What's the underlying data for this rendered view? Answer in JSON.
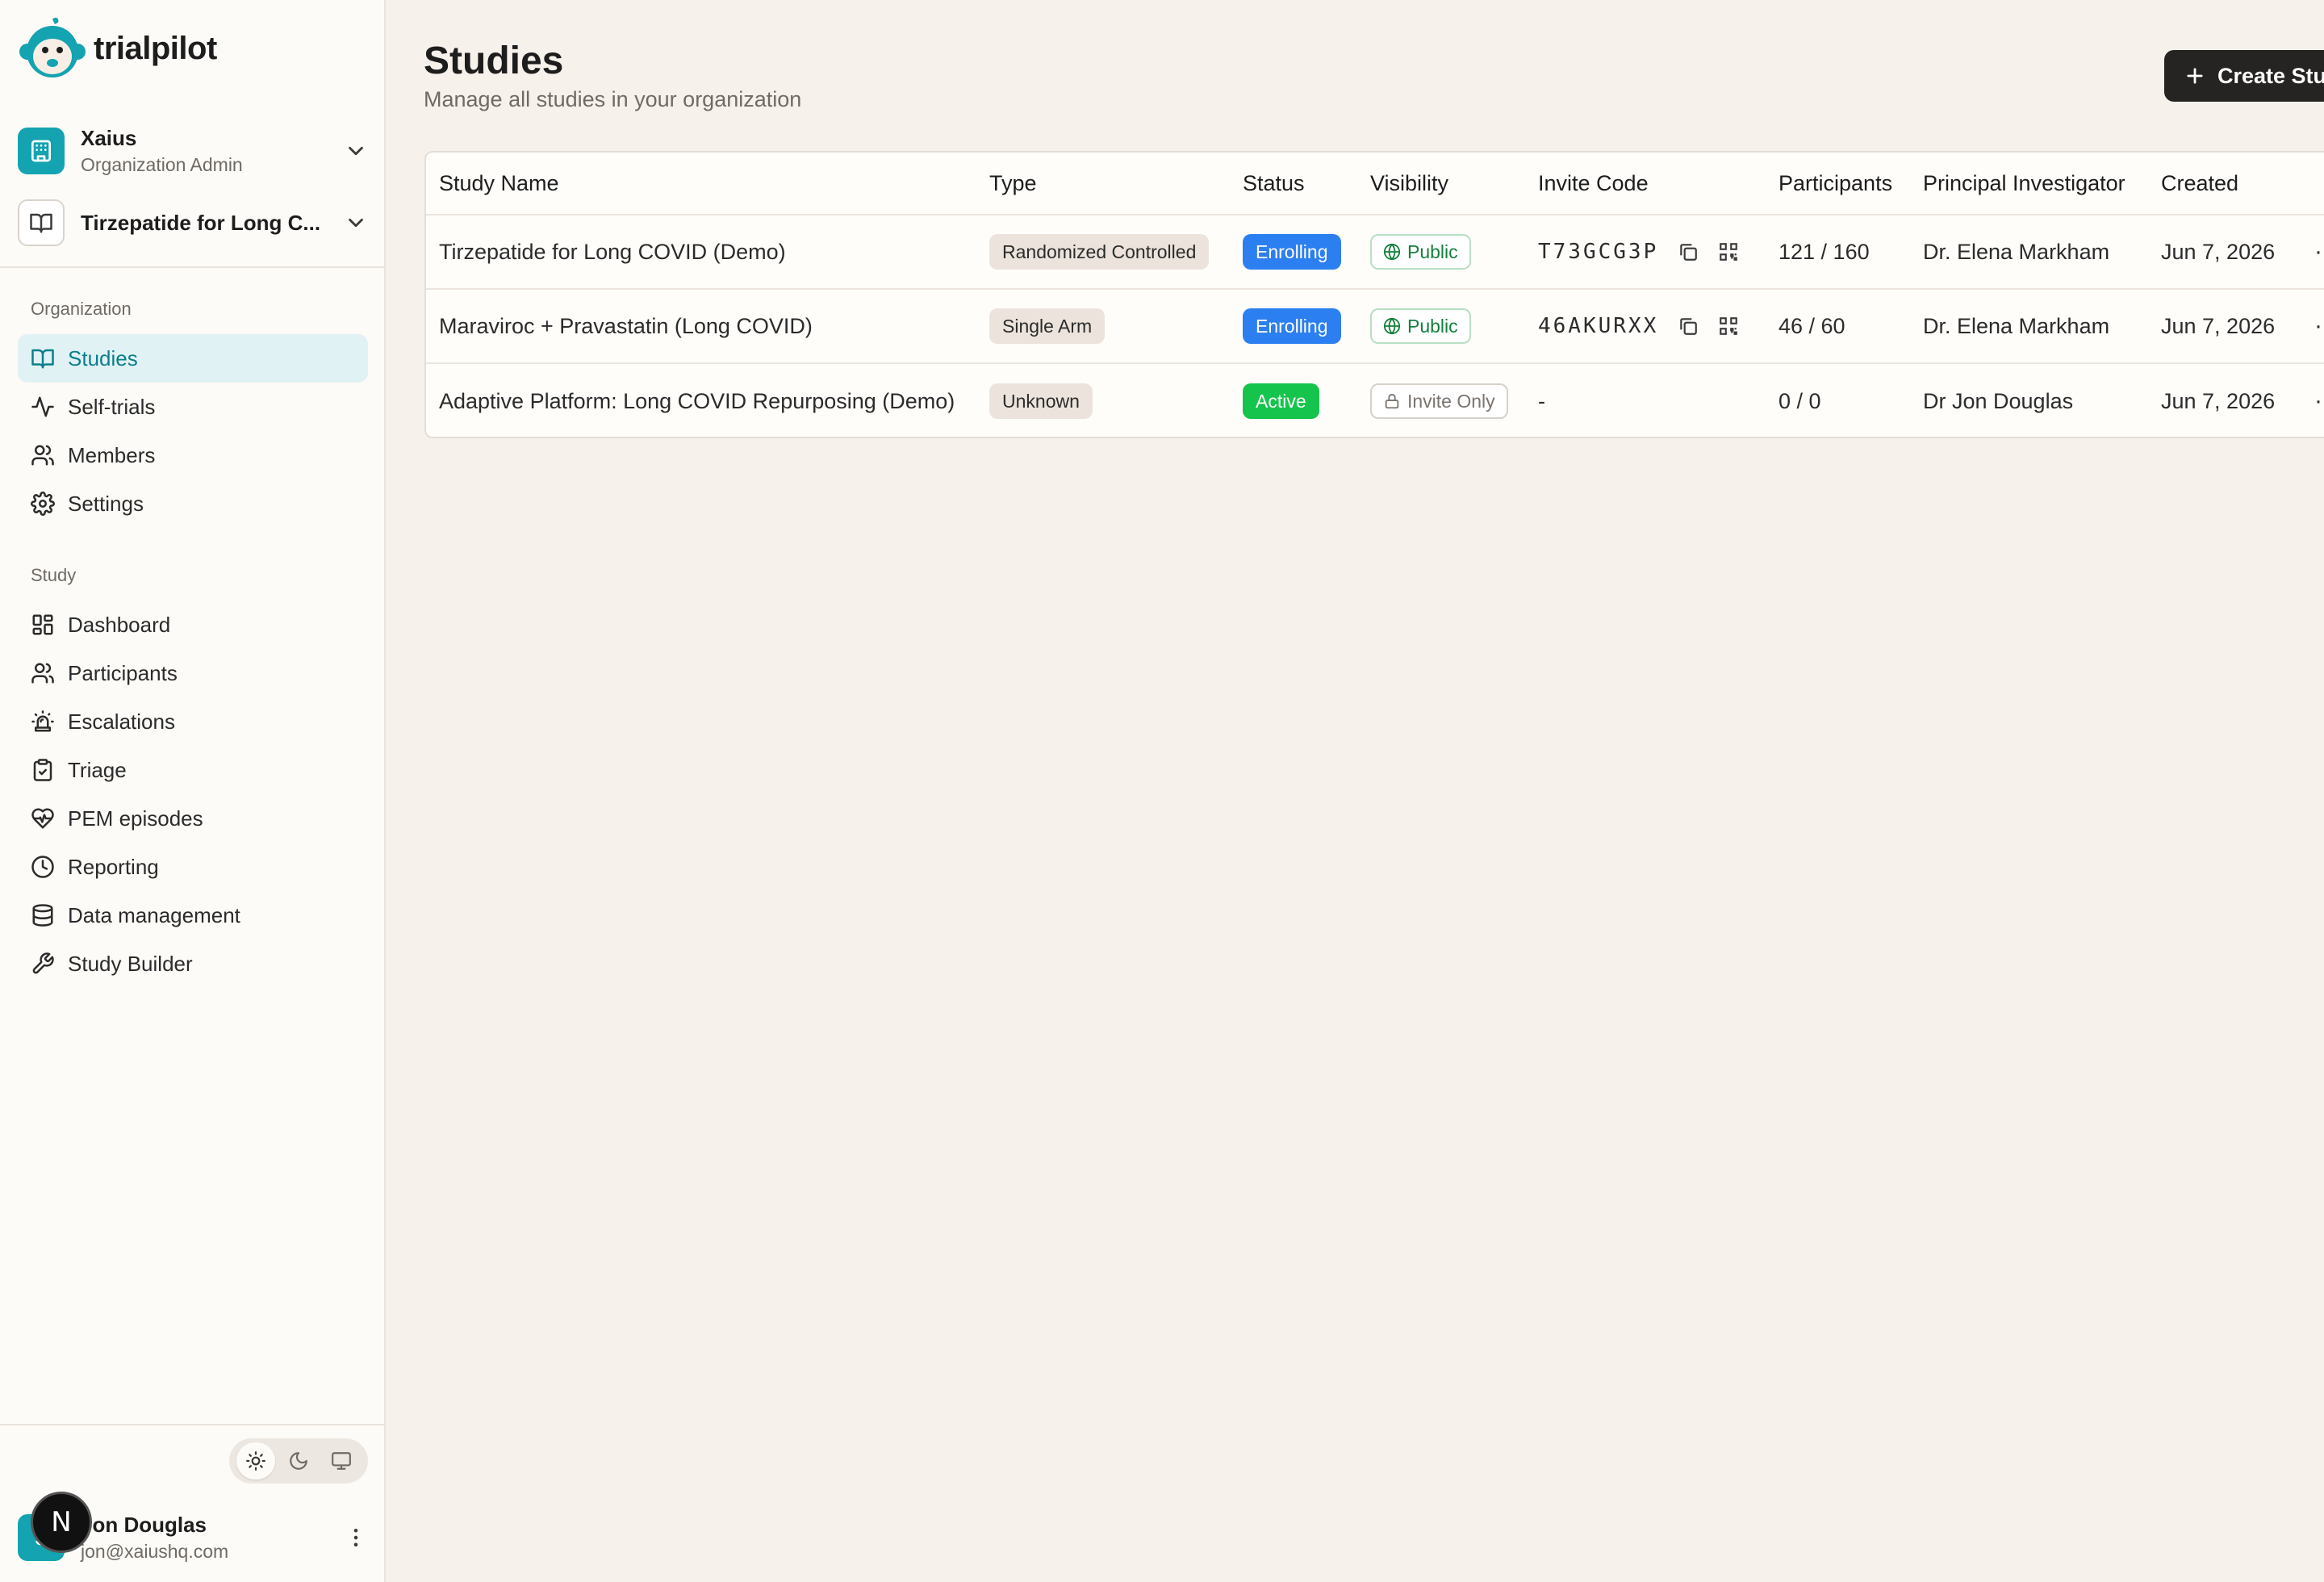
{
  "app": {
    "name": "trialpilot"
  },
  "org_switcher": {
    "name": "Xaius",
    "role": "Organization Admin"
  },
  "study_switcher": {
    "name": "Tirzepatide for Long C..."
  },
  "sidebar": {
    "org_section_label": "Organization",
    "org_items": [
      {
        "label": "Studies",
        "icon": "book-icon",
        "active": true
      },
      {
        "label": "Self-trials",
        "icon": "activity-icon"
      },
      {
        "label": "Members",
        "icon": "users-icon"
      },
      {
        "label": "Settings",
        "icon": "gear-icon"
      }
    ],
    "study_section_label": "Study",
    "study_items": [
      {
        "label": "Dashboard",
        "icon": "grid-icon"
      },
      {
        "label": "Participants",
        "icon": "users-icon"
      },
      {
        "label": "Escalations",
        "icon": "siren-icon"
      },
      {
        "label": "Triage",
        "icon": "clipboard-check-icon"
      },
      {
        "label": "PEM episodes",
        "icon": "heart-pulse-icon"
      },
      {
        "label": "Reporting",
        "icon": "clock-icon"
      },
      {
        "label": "Data management",
        "icon": "database-icon"
      },
      {
        "label": "Study Builder",
        "icon": "wrench-icon"
      }
    ]
  },
  "theme": {
    "selected": "light"
  },
  "user": {
    "name": "Jon Douglas",
    "email": "jon@xaiushq.com",
    "initial": "J"
  },
  "dev_badge": {
    "letter": "N"
  },
  "page": {
    "title": "Studies",
    "subtitle": "Manage all studies in your organization",
    "create_label": "Create Study"
  },
  "table": {
    "headers": {
      "name": "Study Name",
      "type": "Type",
      "status": "Status",
      "visibility": "Visibility",
      "invite": "Invite Code",
      "participants": "Participants",
      "pi": "Principal Investigator",
      "created": "Created"
    },
    "rows": [
      {
        "name": "Tirzepatide for Long COVID (Demo)",
        "type": "Randomized Controlled",
        "status": "Enrolling",
        "visibility": "Public",
        "invite": "T73GCG3P",
        "participants": "121 / 160",
        "pi": "Dr. Elena Markham",
        "created": "Jun 7, 2026",
        "more": "···"
      },
      {
        "name": "Maraviroc + Pravastatin (Long COVID)",
        "type": "Single Arm",
        "status": "Enrolling",
        "visibility": "Public",
        "invite": "46AKURXX",
        "participants": "46 / 60",
        "pi": "Dr. Elena Markham",
        "created": "Jun 7, 2026",
        "more": "···"
      },
      {
        "name": "Adaptive Platform: Long COVID Repurposing (Demo)",
        "type": "Unknown",
        "status": "Active",
        "visibility": "Invite Only",
        "invite": "-",
        "participants": "0 / 0",
        "pi": "Dr Jon Douglas",
        "created": "Jun 7, 2026",
        "more": "···"
      }
    ]
  },
  "colors": {
    "accent": "#14a3b0",
    "enrolling": "#2c7ff0",
    "active": "#15c44c",
    "public": "#15803d"
  }
}
